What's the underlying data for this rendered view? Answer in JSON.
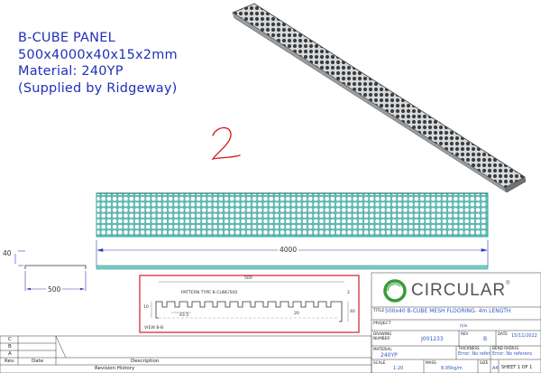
{
  "notes": {
    "line1": "B-CUBE PANEL",
    "line2": "500x4000x40x15x2mm",
    "line3": "Material: 240YP",
    "line4": "(Supplied by Ridgeway)"
  },
  "handwritten_mark": "2",
  "dimensions": {
    "length": "4000",
    "height": "40",
    "width": "500"
  },
  "detail_view": {
    "width_label": "500",
    "pattern_label": "PATTERN TYPE B-CUBE/500",
    "pitch_label": "43.5",
    "left_height": "10",
    "depth_label": "20",
    "right_height": "40",
    "right_top": "2",
    "view_label": "VIEW B-B"
  },
  "title_block": {
    "company": "CIRCULAR",
    "registered": "®",
    "title_label": "TITLE",
    "title_value": "500x40 B-CUBE MESH FLOORING- 4m LENGTH",
    "project_label": "PROJECT",
    "project_value": "n/a",
    "drawing_number_label": "DRAWING NUMBER",
    "drawing_number_value": "J001233",
    "rev_label": "REV",
    "rev_value": "B",
    "date_label": "DATE",
    "date_value": "15/11/2022",
    "material_label": "MATERIAL",
    "material_value": "240YP",
    "thickness_label": "THICKNESS",
    "thickness_value": "Error: No referenc",
    "bend_radius_label": "BEND RADIUS",
    "bend_radius_value": "Error: No referenc",
    "scale_label": "SCALE",
    "scale_value": "1:20",
    "mass_label": "MASS",
    "mass_value": "8.95kg/m",
    "size_label": "SIZE",
    "size_value": "A4",
    "sheet_value": "SHEET 1 OF 1"
  },
  "revision_table": {
    "rows": [
      "C",
      "B",
      "A"
    ],
    "col_rev": "Rev.",
    "col_date": "Date",
    "col_desc": "Description",
    "footer": "Revision History"
  },
  "colors": {
    "ink_blue": "#2030b8",
    "handwriting_red": "#d01818",
    "panel_teal": "#2aa7a0",
    "detail_frame_red": "#d02020",
    "logo_green": "#3a9a3a"
  }
}
